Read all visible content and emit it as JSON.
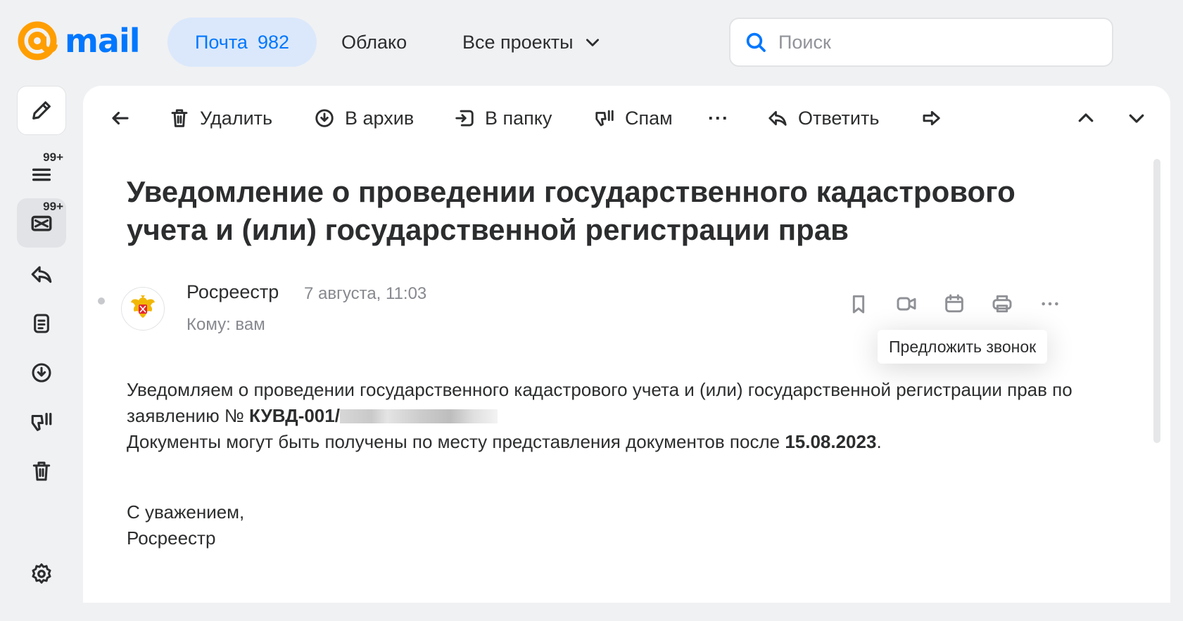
{
  "brand": {
    "logo_text": "mail",
    "accent": "#0077ff",
    "logo_orange": "#ff9e00"
  },
  "nav": {
    "mail_label": "Почта",
    "mail_count": "982",
    "cloud_label": "Облако",
    "projects_label": "Все проекты"
  },
  "search": {
    "placeholder": "Поиск"
  },
  "rail": {
    "items": [
      {
        "name": "compose",
        "icon": "pencil-icon"
      },
      {
        "name": "all-mail",
        "icon": "list-icon",
        "badge": "99+"
      },
      {
        "name": "inbox",
        "icon": "envelope-icon",
        "badge": "99+",
        "active": true
      },
      {
        "name": "sent",
        "icon": "reply-icon"
      },
      {
        "name": "drafts",
        "icon": "document-icon"
      },
      {
        "name": "archive",
        "icon": "archive-icon"
      },
      {
        "name": "spam",
        "icon": "thumbs-down-icon"
      },
      {
        "name": "trash",
        "icon": "trash-icon"
      },
      {
        "name": "settings",
        "icon": "gear-icon"
      }
    ]
  },
  "toolbar": {
    "delete_label": "Удалить",
    "archive_label": "В архив",
    "move_label": "В папку",
    "spam_label": "Спам",
    "more_label": "···",
    "reply_label": "Ответить"
  },
  "message": {
    "subject": "Уведомление о проведении государственного кадастрового учета и (или) государственной регистрации прав",
    "sender": "Росреестр",
    "date": "7 августа, 11:03",
    "to": "Кому: вам",
    "body_line1": "Уведомляем о проведении государственного кадастрового учета и (или) государственной регистрации прав по заявлению №",
    "request_number": "КУВД-001/",
    "body_line2": "Документы могут быть получены по месту представления документов после",
    "release_date": "15.08.2023",
    "body_line2_end": ".",
    "closing": "С уважением,",
    "signature": "Росреестр"
  },
  "message_actions": {
    "icons": [
      "bookmark-icon",
      "video-call-icon",
      "calendar-icon",
      "print-icon",
      "more-icon"
    ],
    "tooltip": "Предложить звонок"
  }
}
